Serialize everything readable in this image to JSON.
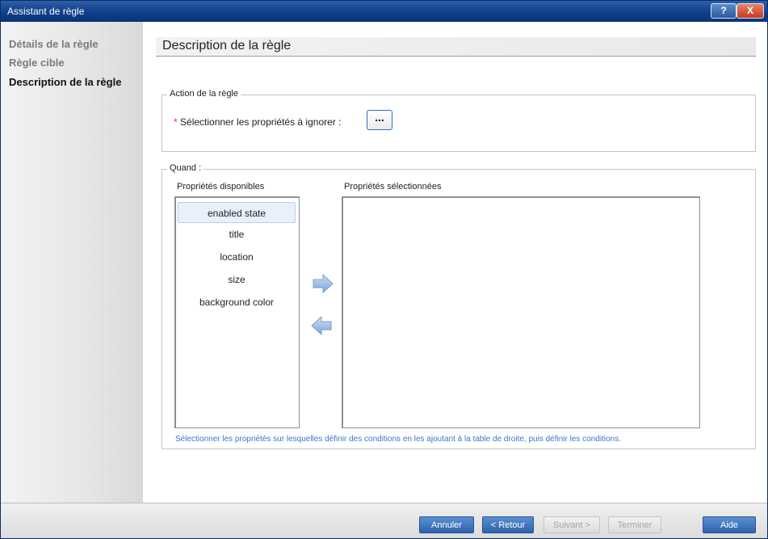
{
  "window": {
    "title": "Assistant de règle",
    "help_label": "?",
    "close_label": "X"
  },
  "sidebar": {
    "items": [
      {
        "label": "Détails de la règle",
        "active": false
      },
      {
        "label": "Règle cible",
        "active": false
      },
      {
        "label": "Description de la règle",
        "active": true
      }
    ]
  },
  "main": {
    "title": "Description de la règle",
    "action_group": {
      "legend": "Action de la règle",
      "required_marker": "*",
      "field_label": "Sélectionner les propriétés à ignorer :",
      "browse_label": "..."
    },
    "when_group": {
      "legend": "Quand :",
      "available_label": "Propriétés disponibles",
      "selected_label": "Propriétés sélectionnées",
      "available": [
        "enabled state",
        "title",
        "location",
        "size",
        "background color"
      ],
      "selected_index": 0,
      "selected": [],
      "add_icon": "arrow-right-icon",
      "remove_icon": "arrow-left-icon",
      "hint": "Sélectionner les propriétés sur lesquelles définir des conditions en les ajoutant à la table de droite, puis définir les conditions."
    }
  },
  "footer": {
    "cancel": "Annuler",
    "back": "< Retour",
    "next": "Suivant >",
    "finish": "Terminer",
    "help": "Aide"
  },
  "colors": {
    "titlebar": "#0f3f8a",
    "accent_button": "#3a70bb",
    "hint_text": "#3a78c4",
    "required": "#e3301f"
  }
}
